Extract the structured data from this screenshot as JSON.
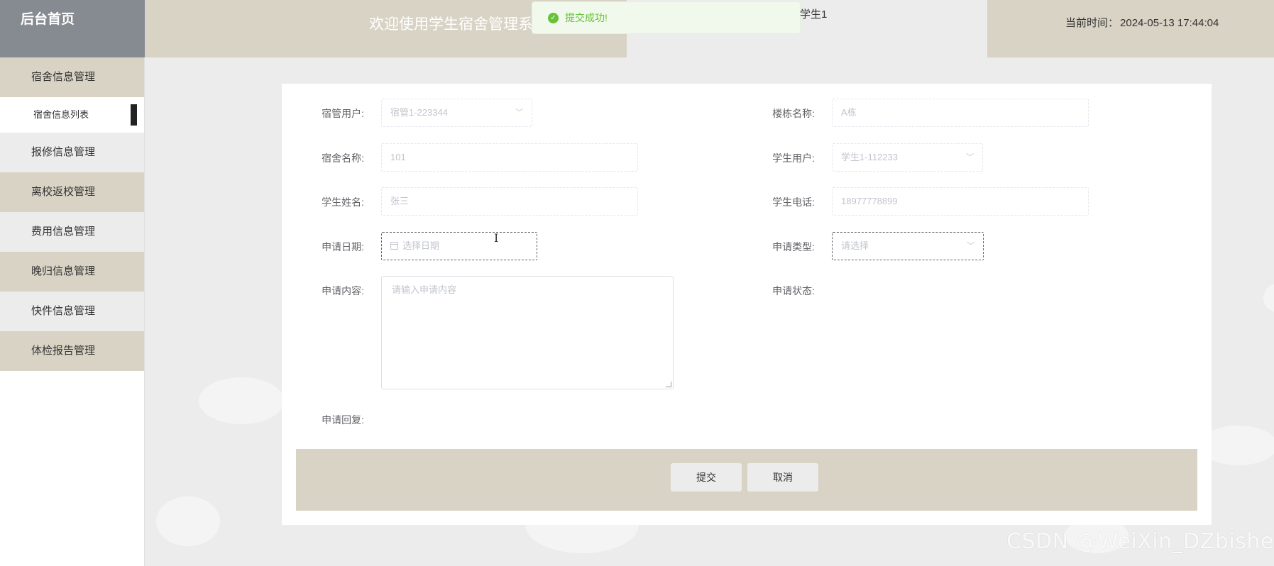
{
  "header": {
    "logo": "后台首页",
    "title": "欢迎使用学生宿舍管理系统",
    "user": "学生1",
    "time_label": "当前时间：",
    "time_value": "2024-05-13 17:44:04"
  },
  "toast": {
    "message": "提交成功!",
    "icon": "check-circle-icon",
    "color": "#67c23a"
  },
  "sidebar": {
    "items": [
      {
        "label": "宿舍信息管理"
      },
      {
        "label": "宿舍信息列表",
        "sub": true
      },
      {
        "label": "报修信息管理"
      },
      {
        "label": "离校返校管理"
      },
      {
        "label": "费用信息管理"
      },
      {
        "label": "晚归信息管理"
      },
      {
        "label": "快件信息管理"
      },
      {
        "label": "体检报告管理"
      }
    ]
  },
  "form": {
    "dorm_manager": {
      "label": "宿管用户:",
      "value": "宿管1-223344"
    },
    "building": {
      "label": "楼栋名称:",
      "value": "A栋"
    },
    "dorm_name": {
      "label": "宿舍名称:",
      "value": "101"
    },
    "student_user": {
      "label": "学生用户:",
      "value": "学生1-112233"
    },
    "student_name": {
      "label": "学生姓名:",
      "value": "张三"
    },
    "student_phone": {
      "label": "学生电话:",
      "value": "18977778899"
    },
    "apply_date": {
      "label": "申请日期:",
      "placeholder": "选择日期"
    },
    "apply_type": {
      "label": "申请类型:",
      "placeholder": "请选择"
    },
    "apply_content": {
      "label": "申请内容:",
      "placeholder": "请输入申请内容"
    },
    "apply_status": {
      "label": "申请状态:"
    },
    "apply_reply": {
      "label": "申请回复:"
    }
  },
  "buttons": {
    "submit": "提交",
    "cancel": "取消"
  },
  "watermark": "CSDN @WeiXin_DZbishe",
  "colors": {
    "accent_beige": "#d9d3c5",
    "logo_gray": "#868b92",
    "background": "#ececec"
  }
}
